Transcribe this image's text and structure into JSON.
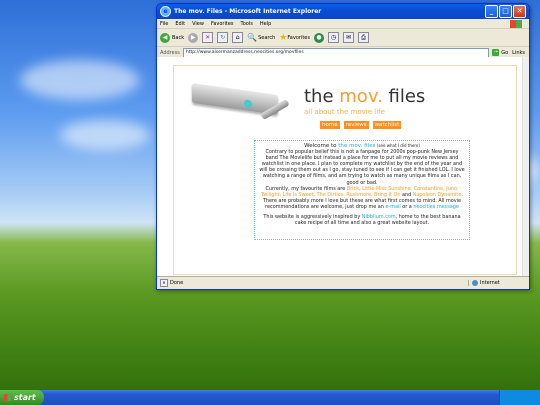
{
  "window": {
    "title": "The mov. Files - Microsoft Internet Explorer",
    "controls": [
      "_",
      "□",
      "✕"
    ]
  },
  "menu": [
    "File",
    "Edit",
    "View",
    "Favorites",
    "Tools",
    "Help"
  ],
  "toolbar": {
    "back_label": "Back",
    "search_label": "Search",
    "favorites_label": "Favorites"
  },
  "address": {
    "label": "Address",
    "url": "http://www.alsermanzaddress.neocities.org/movfiles",
    "go_label": "Go",
    "links_label": "Links"
  },
  "site": {
    "title_part1": "the ",
    "title_mov": "mov.",
    "title_part2": " files",
    "tagline": "all about the movie life",
    "nav": [
      "home",
      "reviews",
      "watchlist"
    ]
  },
  "intro": {
    "welcome_prefix": "Welcome to ",
    "welcome_link": "the mov. files",
    "welcome_note": "(see what I did there)",
    "p1": "Contrary to popular belief this is not a fanpage for 2000s pop-punk New Jersey band The Movielife but instead a place for me to put all my movie reviews and watchlist in one place. I plan to complete my watchlist by the end of the year and will be crossing them out as I go, stay tuned to see if I can get it finished LOL. I love watching a range of films, and am trying to watch as many unique films as I can, good or bad.",
    "fav_prefix": "Currently, my favourite films are ",
    "fav_films": "Brick, Little Miss Sunshine, Constantine, Juno, Twilight, Life Is Sweet, The Dirties, Rushmore, Bring It On",
    "fav_and": " and ",
    "fav_last": "Napoleon Dynamite",
    "p2_rest": ". There are probably more I love but these are what first comes to mind. All movie recommendations are welcome, just drop me an ",
    "email_link": "e-mail",
    "or_text": " or a ",
    "neocities_link": "neocities message",
    "p3_prefix": "This website is aggressively inspired by ",
    "p3_link": "Nibblium.com",
    "p3_rest": ", home to the best banana cake recipe of all time and also a great website layout."
  },
  "status": {
    "left": "Done",
    "zone": "Internet"
  },
  "taskbar": {
    "start_label": "start"
  }
}
